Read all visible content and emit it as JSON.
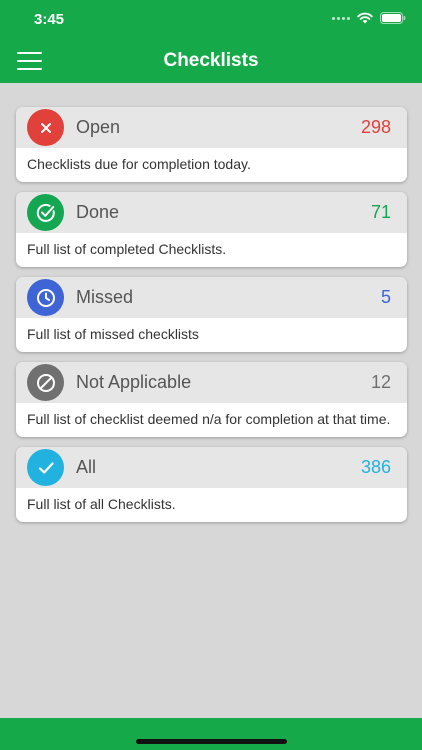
{
  "status_bar": {
    "time": "3:45",
    "icons": [
      "signal-dots",
      "wifi-icon",
      "battery-icon"
    ]
  },
  "header": {
    "title": "Checklists",
    "menu_icon": "hamburger-menu-icon",
    "color": "#16a94a"
  },
  "checklists": [
    {
      "key": "open",
      "title": "Open",
      "count": "298",
      "description": "Checklists due for completion today.",
      "icon": "x-icon",
      "color": "#e2403a"
    },
    {
      "key": "done",
      "title": "Done",
      "count": "71",
      "description": "Full list of completed Checklists.",
      "icon": "check-circle-icon",
      "color": "#14a651"
    },
    {
      "key": "missed",
      "title": "Missed",
      "count": "5",
      "description": "Full list of missed checklists",
      "icon": "clock-icon",
      "color": "#3e64d6"
    },
    {
      "key": "not-applicable",
      "title": "Not Applicable",
      "count": "12",
      "description": "Full list of checklist deemed n/a for completion at that time.",
      "icon": "no-entry-icon",
      "color": "#707070"
    },
    {
      "key": "all",
      "title": "All",
      "count": "386",
      "description": "Full list of all Checklists.",
      "icon": "checkmark-icon",
      "color": "#21b2df"
    }
  ]
}
